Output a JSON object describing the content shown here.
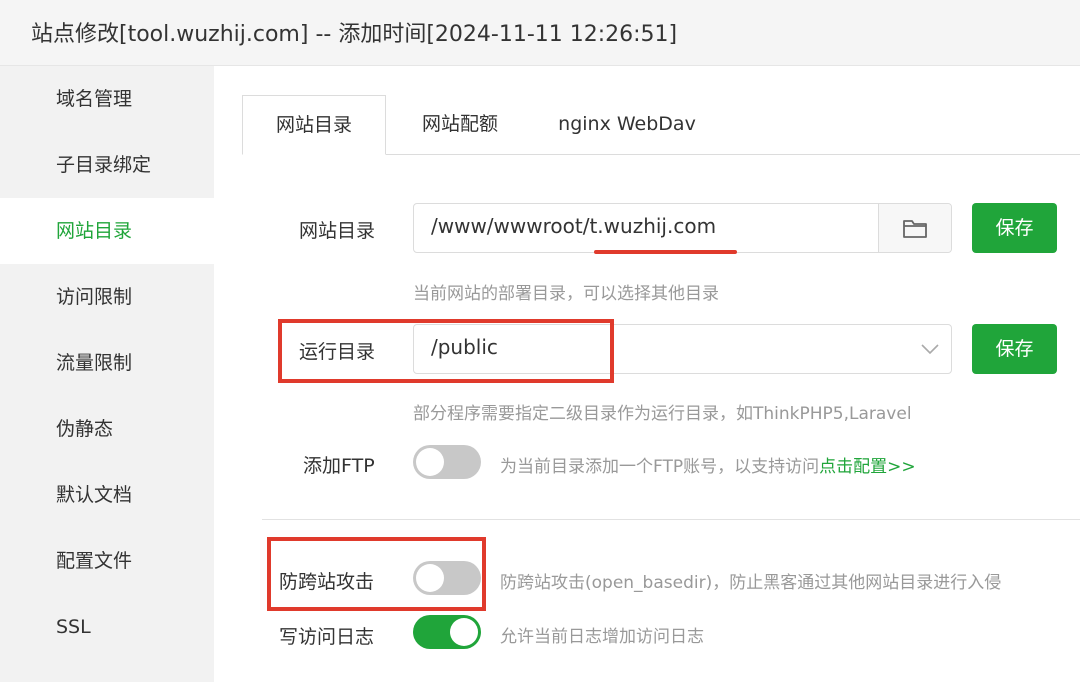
{
  "window": {
    "title": "站点修改[tool.wuzhij.com] -- 添加时间[2024-11-11 12:26:51]"
  },
  "sidebar": {
    "items": [
      {
        "label": "域名管理"
      },
      {
        "label": "子目录绑定"
      },
      {
        "label": "网站目录",
        "active": true
      },
      {
        "label": "访问限制"
      },
      {
        "label": "流量限制"
      },
      {
        "label": "伪静态"
      },
      {
        "label": "默认文档"
      },
      {
        "label": "配置文件"
      },
      {
        "label": "SSL"
      }
    ]
  },
  "tabs": [
    {
      "label": "网站目录",
      "active": true
    },
    {
      "label": "网站配额"
    },
    {
      "label": "nginx WebDav"
    }
  ],
  "site_dir": {
    "label": "网站目录",
    "value": "/www/wwwroot/t.wuzhij.com",
    "save_label": "保存",
    "hint": "当前网站的部署目录，可以选择其他目录",
    "icon": "folder-icon"
  },
  "run_dir": {
    "label": "运行目录",
    "value": "/public",
    "save_label": "保存",
    "hint": "部分程序需要指定二级目录作为运行目录，如ThinkPHP5,Laravel",
    "icon": "chevron-down-icon"
  },
  "ftp": {
    "label": "添加FTP",
    "enabled": false,
    "hint_prefix": "为当前目录添加一个FTP账号，以支持访问",
    "hint_link": "点击配置>>"
  },
  "cross_site": {
    "label": "防跨站攻击",
    "enabled": false,
    "hint": "防跨站攻击(open_basedir)，防止黑客通过其他网站目录进行入侵"
  },
  "access_log": {
    "label": "写访问日志",
    "enabled": true,
    "hint": "允许当前日志增加访问日志"
  },
  "colors": {
    "accent": "#20a53a",
    "annotation": "#e03a2c",
    "sidebar_bg": "#f2f2f2"
  }
}
